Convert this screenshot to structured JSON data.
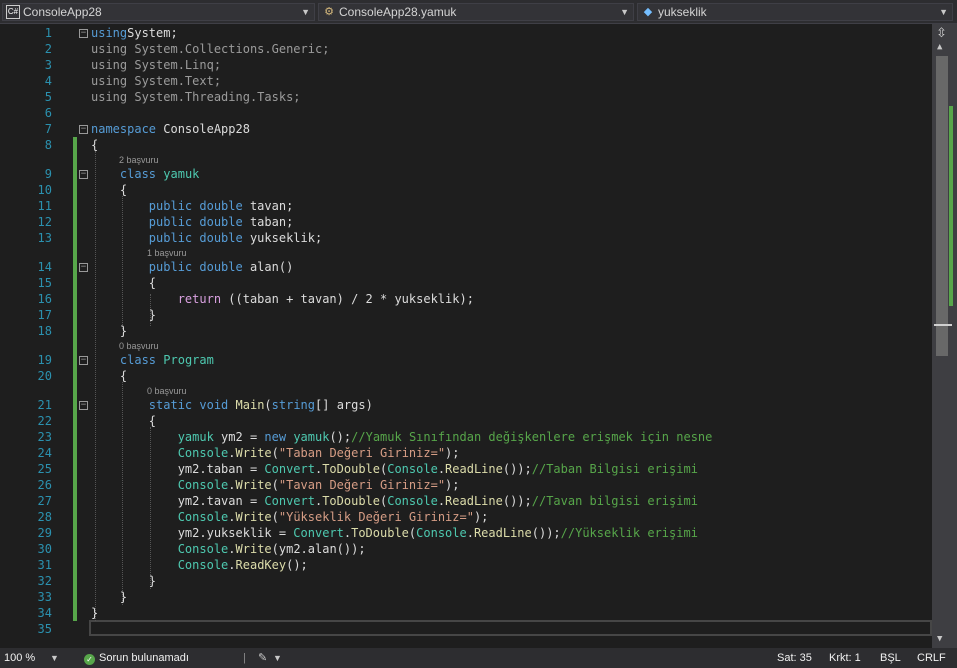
{
  "nav": {
    "project": "ConsoleApp28",
    "type": "ConsoleApp28.yamuk",
    "member": "yukseklik"
  },
  "editor": {
    "lines": [
      {
        "n": "1",
        "tokens": [
          [
            "kw",
            "using"
          ],
          [
            "",
            "System;"
          ]
        ]
      },
      {
        "n": "2",
        "tokens": [
          [
            "ns",
            "using System.Collections.Generic;"
          ]
        ]
      },
      {
        "n": "3",
        "tokens": [
          [
            "ns",
            "using System.Linq;"
          ]
        ]
      },
      {
        "n": "4",
        "tokens": [
          [
            "ns",
            "using System.Text;"
          ]
        ]
      },
      {
        "n": "5",
        "tokens": [
          [
            "ns",
            "using System.Threading.Tasks;"
          ]
        ]
      },
      {
        "n": "6",
        "tokens": []
      },
      {
        "n": "7",
        "tokens": [
          [
            "kw",
            "namespace"
          ],
          [
            "",
            " ConsoleApp28"
          ]
        ]
      },
      {
        "n": "8",
        "tokens": [
          [
            "",
            "{"
          ]
        ]
      },
      {
        "n": "9",
        "lens": "2 başvuru",
        "tokens": [
          [
            "",
            "    "
          ],
          [
            "kw",
            "class"
          ],
          [
            "",
            " "
          ],
          [
            "ty",
            "yamuk"
          ]
        ]
      },
      {
        "n": "10",
        "tokens": [
          [
            "",
            "    {"
          ]
        ]
      },
      {
        "n": "11",
        "tokens": [
          [
            "",
            "        "
          ],
          [
            "kw",
            "public double"
          ],
          [
            "",
            " tavan;"
          ]
        ]
      },
      {
        "n": "12",
        "tokens": [
          [
            "",
            "        "
          ],
          [
            "kw",
            "public double"
          ],
          [
            "",
            " taban;"
          ]
        ]
      },
      {
        "n": "13",
        "tokens": [
          [
            "",
            "        "
          ],
          [
            "kw",
            "public double"
          ],
          [
            "",
            " yukseklik;"
          ]
        ]
      },
      {
        "n": "14",
        "lens": "1 başvuru",
        "tokens": [
          [
            "",
            "        "
          ],
          [
            "kw",
            "public double"
          ],
          [
            "",
            " alan()"
          ]
        ]
      },
      {
        "n": "15",
        "tokens": [
          [
            "",
            "        {"
          ]
        ]
      },
      {
        "n": "16",
        "tokens": [
          [
            "",
            "            "
          ],
          [
            "ctl",
            "return"
          ],
          [
            "",
            " ((taban + tavan) / 2 * yukseklik);"
          ]
        ]
      },
      {
        "n": "17",
        "tokens": [
          [
            "",
            "        }"
          ]
        ]
      },
      {
        "n": "18",
        "tokens": [
          [
            "",
            "    }"
          ]
        ]
      },
      {
        "n": "19",
        "lens": "0 başvuru",
        "tokens": [
          [
            "",
            "    "
          ],
          [
            "kw",
            "class"
          ],
          [
            "",
            " "
          ],
          [
            "ty",
            "Program"
          ]
        ]
      },
      {
        "n": "20",
        "tokens": [
          [
            "",
            "    {"
          ]
        ]
      },
      {
        "n": "21",
        "lens": "0 başvuru",
        "tokens": [
          [
            "",
            "        "
          ],
          [
            "kw",
            "static void"
          ],
          [
            "",
            " "
          ],
          [
            "fn",
            "Main"
          ],
          [
            "",
            "("
          ],
          [
            "kw",
            "string"
          ],
          [
            "",
            "[] args)"
          ]
        ]
      },
      {
        "n": "22",
        "tokens": [
          [
            "",
            "        {"
          ]
        ]
      },
      {
        "n": "23",
        "tokens": [
          [
            "",
            "            "
          ],
          [
            "ty",
            "yamuk"
          ],
          [
            "",
            " ym2 = "
          ],
          [
            "kw",
            "new"
          ],
          [
            "",
            " "
          ],
          [
            "ty",
            "yamuk"
          ],
          [
            "",
            "();"
          ],
          [
            "cm",
            "//Yamuk Sınıfından değişkenlere erişmek için nesne"
          ]
        ]
      },
      {
        "n": "24",
        "tokens": [
          [
            "",
            "            "
          ],
          [
            "ty",
            "Console"
          ],
          [
            "",
            "."
          ],
          [
            "fn",
            "Write"
          ],
          [
            "",
            "("
          ],
          [
            "str",
            "\"Taban Değeri Giriniz=\""
          ],
          [
            "",
            ");"
          ]
        ]
      },
      {
        "n": "25",
        "tokens": [
          [
            "",
            "            ym2.taban = "
          ],
          [
            "ty",
            "Convert"
          ],
          [
            "",
            "."
          ],
          [
            "fn",
            "ToDouble"
          ],
          [
            "",
            "("
          ],
          [
            "ty",
            "Console"
          ],
          [
            "",
            "."
          ],
          [
            "fn",
            "ReadLine"
          ],
          [
            "",
            "());"
          ],
          [
            "cm",
            "//Taban Bilgisi erişimi"
          ]
        ]
      },
      {
        "n": "26",
        "tokens": [
          [
            "",
            "            "
          ],
          [
            "ty",
            "Console"
          ],
          [
            "",
            "."
          ],
          [
            "fn",
            "Write"
          ],
          [
            "",
            "("
          ],
          [
            "str",
            "\"Tavan Değeri Giriniz=\""
          ],
          [
            "",
            ");"
          ]
        ]
      },
      {
        "n": "27",
        "tokens": [
          [
            "",
            "            ym2.tavan = "
          ],
          [
            "ty",
            "Convert"
          ],
          [
            "",
            "."
          ],
          [
            "fn",
            "ToDouble"
          ],
          [
            "",
            "("
          ],
          [
            "ty",
            "Console"
          ],
          [
            "",
            "."
          ],
          [
            "fn",
            "ReadLine"
          ],
          [
            "",
            "());"
          ],
          [
            "cm",
            "//Tavan bilgisi erişimi"
          ]
        ]
      },
      {
        "n": "28",
        "tokens": [
          [
            "",
            "            "
          ],
          [
            "ty",
            "Console"
          ],
          [
            "",
            "."
          ],
          [
            "fn",
            "Write"
          ],
          [
            "",
            "("
          ],
          [
            "str",
            "\"Yükseklik Değeri Giriniz=\""
          ],
          [
            "",
            ");"
          ]
        ]
      },
      {
        "n": "29",
        "tokens": [
          [
            "",
            "            ym2.yukseklik = "
          ],
          [
            "ty",
            "Convert"
          ],
          [
            "",
            "."
          ],
          [
            "fn",
            "ToDouble"
          ],
          [
            "",
            "("
          ],
          [
            "ty",
            "Console"
          ],
          [
            "",
            "."
          ],
          [
            "fn",
            "ReadLine"
          ],
          [
            "",
            "());"
          ],
          [
            "cm",
            "//Yükseklik erişimi"
          ]
        ]
      },
      {
        "n": "30",
        "tokens": [
          [
            "",
            "            "
          ],
          [
            "ty",
            "Console"
          ],
          [
            "",
            "."
          ],
          [
            "fn",
            "Write"
          ],
          [
            "",
            "(ym2.alan());"
          ]
        ]
      },
      {
        "n": "31",
        "tokens": [
          [
            "",
            "            "
          ],
          [
            "ty",
            "Console"
          ],
          [
            "",
            "."
          ],
          [
            "fn",
            "ReadKey"
          ],
          [
            "",
            "();"
          ]
        ]
      },
      {
        "n": "32",
        "tokens": [
          [
            "",
            "        }"
          ]
        ]
      },
      {
        "n": "33",
        "tokens": [
          [
            "",
            "    }"
          ]
        ]
      },
      {
        "n": "34",
        "tokens": [
          [
            "",
            "}"
          ]
        ]
      },
      {
        "n": "35",
        "tokens": []
      }
    ]
  },
  "status": {
    "zoom": "100 %",
    "issues": "Sorun bulunamadı",
    "line": "Sat: 35",
    "col": "Krkt: 1",
    "mode": "BŞL",
    "eol": "CRLF"
  }
}
